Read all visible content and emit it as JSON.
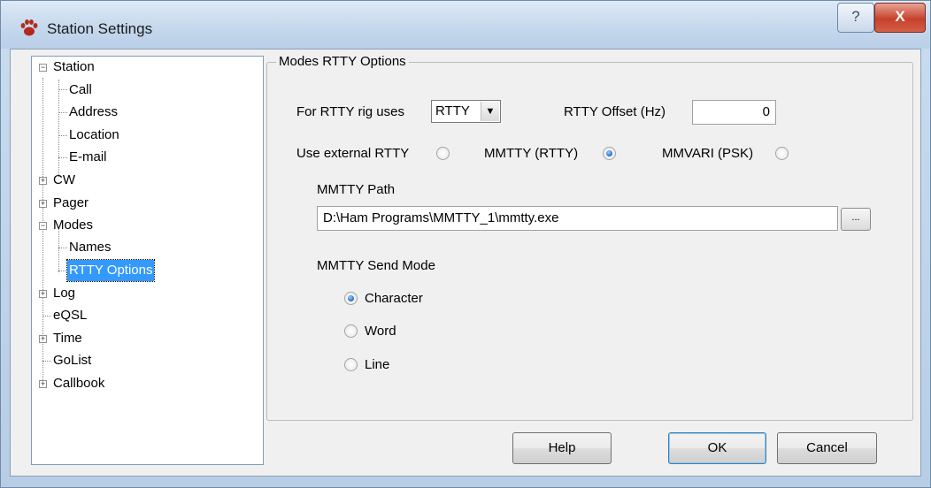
{
  "window": {
    "title": "Station Settings"
  },
  "caption": {
    "help": "?",
    "close": "X"
  },
  "tree": {
    "items": [
      {
        "label": "Station",
        "expander": "−"
      },
      {
        "label": "Call"
      },
      {
        "label": "Address"
      },
      {
        "label": "Location"
      },
      {
        "label": "E-mail"
      },
      {
        "label": "CW",
        "expander": "+"
      },
      {
        "label": "Pager",
        "expander": "+"
      },
      {
        "label": "Modes",
        "expander": "−"
      },
      {
        "label": "Names"
      },
      {
        "label": "RTTY Options",
        "selected": true
      },
      {
        "label": "Log",
        "expander": "+"
      },
      {
        "label": "eQSL"
      },
      {
        "label": "Time",
        "expander": "+"
      },
      {
        "label": "GoList"
      },
      {
        "label": "Callbook",
        "expander": "+"
      }
    ]
  },
  "panel": {
    "group_title": "Modes RTTY Options",
    "rig_uses_label": "For RTTY rig uses",
    "rig_uses_value": "RTTY",
    "offset_label": "RTTY Offset (Hz)",
    "offset_value": "0",
    "use_external_label": "Use external RTTY",
    "mmtty_label": "MMTTY (RTTY)",
    "mmvari_label": "MMVARI (PSK)",
    "path_label": "MMTTY Path",
    "path_value": "D:\\Ham Programs\\MMTTY_1\\mmtty.exe",
    "browse_label": "...",
    "send_mode_label": "MMTTY Send Mode",
    "send_modes": [
      "Character",
      "Word",
      "Line"
    ]
  },
  "buttons": {
    "help": "Help",
    "ok": "OK",
    "cancel": "Cancel"
  },
  "colors": {
    "selection": "#3399ff",
    "window_frame": "#b9cfe8"
  }
}
